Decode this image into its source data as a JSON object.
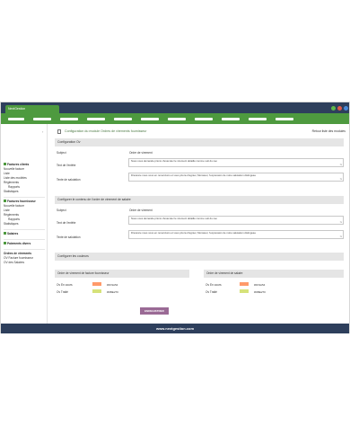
{
  "window": {
    "tab_label": "NextGestion",
    "traffic_lights": [
      "#5fb84a",
      "#e05a4a",
      "#4a8ad8"
    ]
  },
  "topnav": {
    "color": "#4e9a3f"
  },
  "sidebar": {
    "sections": [
      {
        "title": "Factures clients",
        "items": [
          "Nouvelle facture",
          "Liste",
          "Liste des modèles",
          "Règlements",
          "Rapports",
          "Statistiques"
        ]
      },
      {
        "title": "Factures fournisseur",
        "items": [
          "Nouvelle facture",
          "Liste",
          "Règlements",
          "Rapports",
          "Statistiques"
        ]
      },
      {
        "title": "Salaires",
        "items": []
      },
      {
        "title": "Paiements divers",
        "items": []
      },
      {
        "title": "Ordres de virements",
        "items": [
          "OV Facture fournisseur",
          "OV des Salaires"
        ]
      }
    ]
  },
  "header": {
    "title": "Configuration du module Ordres de virements fournisseur",
    "back_link": "Retour liste des modules"
  },
  "ov": {
    "title": "Configuration Ov",
    "subject_label": "Subject",
    "subject_value": "Ordre de virement",
    "entete_label": "Text de l'entête",
    "entete_value": "Nous vous demande prions d'exécuter le virement détaillé comme suit du ceo",
    "salutation_label": "Texte de salutation",
    "salutation_value": "D'avance nous vous en remercions et vous prions d'agréer, Monsieur, l'expression de notre salutation distinguée"
  },
  "salaire": {
    "title": "Configurer le contenu de l'ordre de virement de salaire",
    "subject_label": "Subject",
    "subject_value": "Ordre de virement",
    "entete_label": "Text de l'entête",
    "entete_value": "Nous vous demande prions d'exécuter le virement détaillé comme suit du ceo",
    "salutation_label": "Texte de salutation",
    "salutation_value": "D'avance nous vous en remercions et vous prions d'agréer, Monsieur, l'expression de notre salutation distinguée"
  },
  "couleurs": {
    "title": "Configurer les couleurs",
    "fournisseur": {
      "title": "Ordre de virement de facture fournisseur",
      "rows": [
        {
          "label": "Ov En cours",
          "color": "#FF9A6A",
          "hex": "#FF9A54"
        },
        {
          "label": "Ov Traité",
          "color": "#D6E27A",
          "hex": "#DBE270"
        }
      ]
    },
    "salaire": {
      "title": "Ordre de virement de salaire",
      "rows": [
        {
          "label": "Ov En cours",
          "color": "#FF9A6A",
          "hex": "#FF9A54"
        },
        {
          "label": "Ov Traité",
          "color": "#D6E27A",
          "hex": "#DBE270"
        }
      ]
    }
  },
  "save_label": "ENREGISTRER",
  "footer": "www.nextgestion.com"
}
